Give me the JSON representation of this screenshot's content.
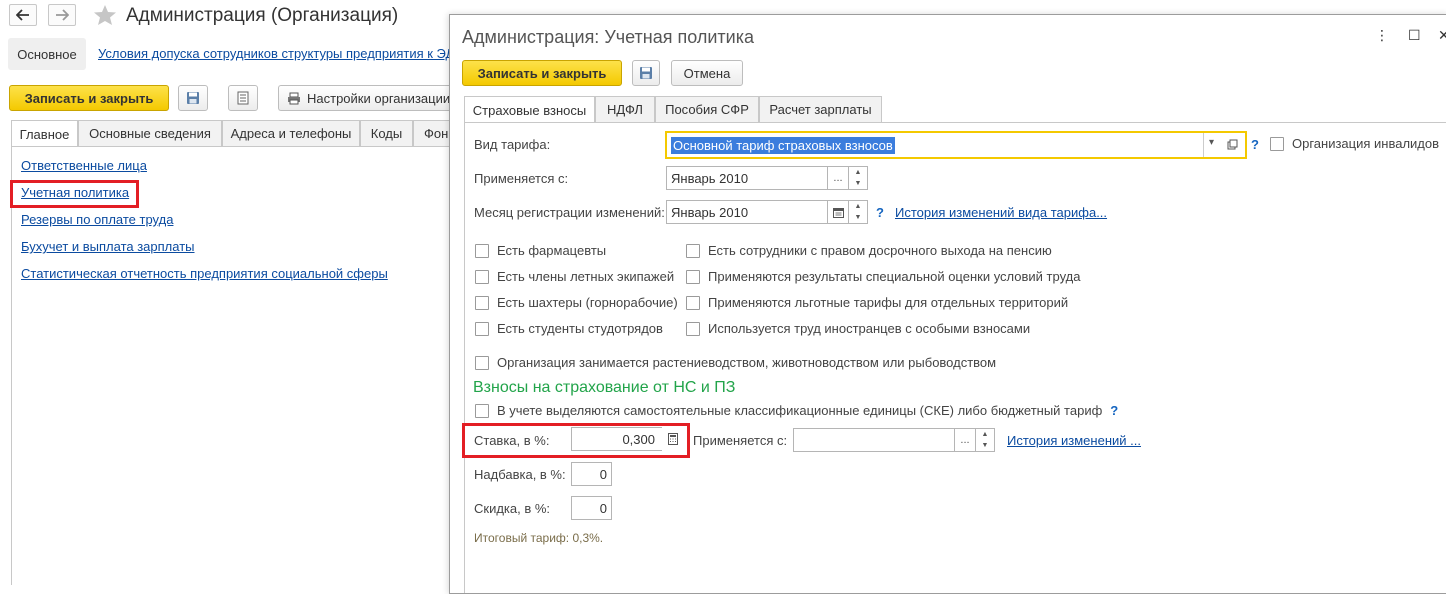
{
  "background_window": {
    "title": "Администрация (Организация)",
    "tab_main": "Основное",
    "sub_link": "Условия допуска сотрудников структуры предприятия к ЭД",
    "save_close": "Записать и закрыть",
    "settings_btn": "Настройки организации",
    "tabs": [
      "Главное",
      "Основные сведения",
      "Адреса и телефоны",
      "Коды",
      "Фон"
    ],
    "links": [
      "Ответственные лица",
      "Учетная политика",
      "Резервы по оплате труда",
      "Бухучет и выплата зарплаты",
      "Статистическая отчетность предприятия социальной сферы"
    ]
  },
  "modal": {
    "title": "Администрация: Учетная политика",
    "save_close": "Записать и закрыть",
    "cancel": "Отмена",
    "tabs": [
      "Страховые взносы",
      "НДФЛ",
      "Пособия СФР",
      "Расчет зарплаты"
    ],
    "tariff_label": "Вид тарифа:",
    "tariff_value": "Основной тариф страховых взносов",
    "disabled_org": "Организация инвалидов",
    "applies_from_label": "Применяется с:",
    "applies_from_value": "Январь 2010",
    "reg_month_label": "Месяц регистрации изменений:",
    "reg_month_value": "Январь 2010",
    "tariff_history": "История изменений вида тарифа...",
    "checkboxes_left": [
      "Есть фармацевты",
      "Есть члены летных экипажей",
      "Есть шахтеры (горнорабочие)",
      "Есть студенты студотрядов"
    ],
    "checkboxes_right": [
      "Есть сотрудники с правом досрочного выхода на пенсию",
      "Применяются результаты специальной оценки условий труда",
      "Применяются льготные тарифы для отдельных территорий",
      "Используется труд иностранцев с особыми взносами"
    ],
    "checkbox_agri": "Организация занимается растениеводством, животноводством или рыбоводством",
    "section_ns": "Взносы на страхование от НС и ПЗ",
    "checkbox_ske": "В учете выделяются самостоятельные классификационные единицы (СКЕ) либо бюджетный тариф",
    "rate_label": "Ставка, в %:",
    "rate_value": "0,300",
    "rate_applies_label": "Применяется с:",
    "rate_applies_value": "",
    "rate_history": "История изменений ...",
    "markup_label": "Надбавка, в %:",
    "markup_value": "0",
    "discount_label": "Скидка, в %:",
    "discount_value": "0",
    "total_tariff": "Итоговый тариф: 0,3%.",
    "help_symbol": "?",
    "ellipsis": "...",
    "dropdown_arrow": "▾"
  },
  "colors": {
    "accent_yellow": "#f4c900",
    "link_blue": "#0b4ba0",
    "highlight_red": "#e31e24",
    "section_green": "#22a44a",
    "selection_blue": "#3b7ddd"
  }
}
